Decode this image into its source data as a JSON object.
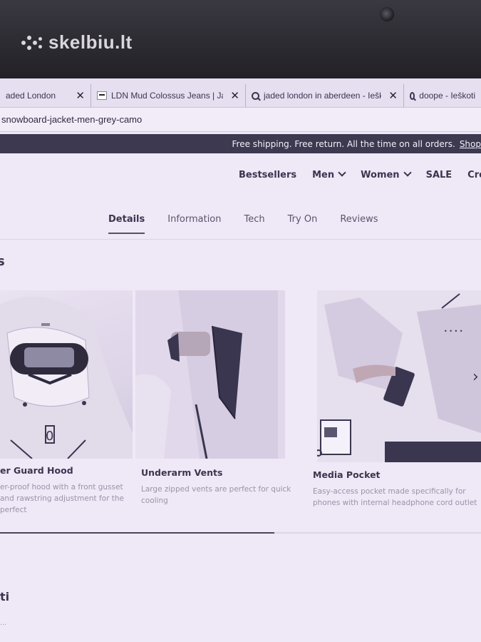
{
  "logo": {
    "text": "skelbiu.lt"
  },
  "browser": {
    "tabs": [
      {
        "label": "aded London",
        "icon": "none",
        "close": "✕"
      },
      {
        "label": "LDN Mud Colossus Jeans | Jaded …",
        "icon": "favicon-icon",
        "close": "✕"
      },
      {
        "label": "jaded london in aberdeen - Ieškoti",
        "icon": "search-icon",
        "close": "✕"
      },
      {
        "label": "doope - Ieškoti",
        "icon": "search-icon",
        "close": ""
      }
    ],
    "url": "snowboard-jacket-men-grey-camo"
  },
  "promo": {
    "text": "Free shipping. Free return. All the time on all orders.",
    "link": "Shop"
  },
  "nav": {
    "items": [
      {
        "label": "Bestsellers",
        "dropdown": false
      },
      {
        "label": "Men",
        "dropdown": true
      },
      {
        "label": "Women",
        "dropdown": true
      },
      {
        "label": "SALE",
        "dropdown": false
      },
      {
        "label": "Create C",
        "dropdown": false
      }
    ]
  },
  "product_tabs": [
    "Details",
    "Information",
    "Tech",
    "Try On",
    "Reviews"
  ],
  "active_tab": "Details",
  "section_heading": "s",
  "features": [
    {
      "title": "er Guard Hood",
      "desc": "er-proof hood with a front gusset and rawstring adjustment for the perfect"
    },
    {
      "title": "Underarm Vents",
      "desc": "Large zipped vents are perfect for quick cooling"
    },
    {
      "title": "Media Pocket",
      "desc": "Easy-access pocket made specifically for phones with internal headphone cord outlet"
    }
  ],
  "carousel": {
    "progress": 0.57
  },
  "image_label": "0",
  "bottom": {
    "heading": "ti",
    "para": "…"
  },
  "colors": {
    "promo_bg": "#3c3950",
    "screen_bg": "#efe8f6",
    "text_dark": "#3b3550"
  }
}
